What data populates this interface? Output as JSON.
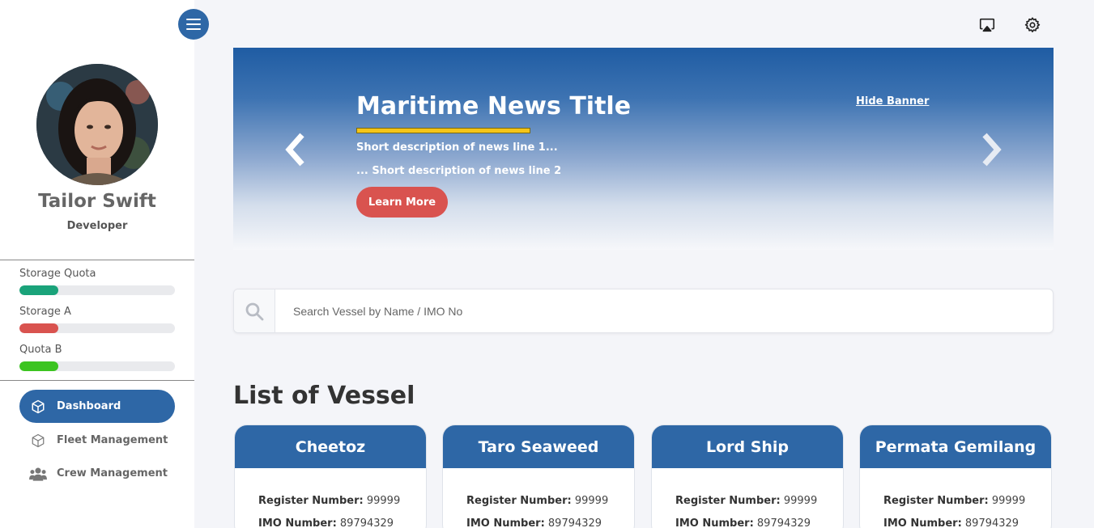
{
  "user": {
    "name": "Tailor Swift",
    "role": "Developer"
  },
  "quotas": [
    {
      "label": "Storage Quota",
      "fill": 0.25,
      "color": "#1aa37a"
    },
    {
      "label": "Storage A",
      "fill": 0.25,
      "color": "#d9534f"
    },
    {
      "label": "Quota B",
      "fill": 0.25,
      "color": "#3bc420"
    }
  ],
  "nav": [
    {
      "label": "Dashboard",
      "icon": "cube-icon",
      "active": true
    },
    {
      "label": "Fleet Management",
      "icon": "cube-icon",
      "active": false
    },
    {
      "label": "Crew Management",
      "icon": "users-icon",
      "active": false
    }
  ],
  "banner": {
    "title": "Maritime News Title",
    "line1": "Short description of news line 1...",
    "line2": "... Short description of news line 2",
    "learn_more": "Learn More",
    "hide": "Hide Banner"
  },
  "search": {
    "placeholder": "Search Vessel by Name / IMO No"
  },
  "list_title": "List of Vessel",
  "vessels": [
    {
      "name": "Cheetoz",
      "register_label": "Register Number:",
      "register": "99999",
      "imo_label": "IMO Number:",
      "imo": "89794329"
    },
    {
      "name": "Taro Seaweed",
      "register_label": "Register Number:",
      "register": "99999",
      "imo_label": "IMO Number:",
      "imo": "89794329"
    },
    {
      "name": "Lord Ship",
      "register_label": "Register Number:",
      "register": "99999",
      "imo_label": "IMO Number:",
      "imo": "89794329"
    },
    {
      "name": "Permata Gemilang",
      "register_label": "Register Number:",
      "register": "99999",
      "imo_label": "IMO Number:",
      "imo": "89794329"
    }
  ],
  "colors": {
    "primary": "#2e67a6",
    "accent": "#d9534f",
    "highlight": "#f5c518"
  }
}
